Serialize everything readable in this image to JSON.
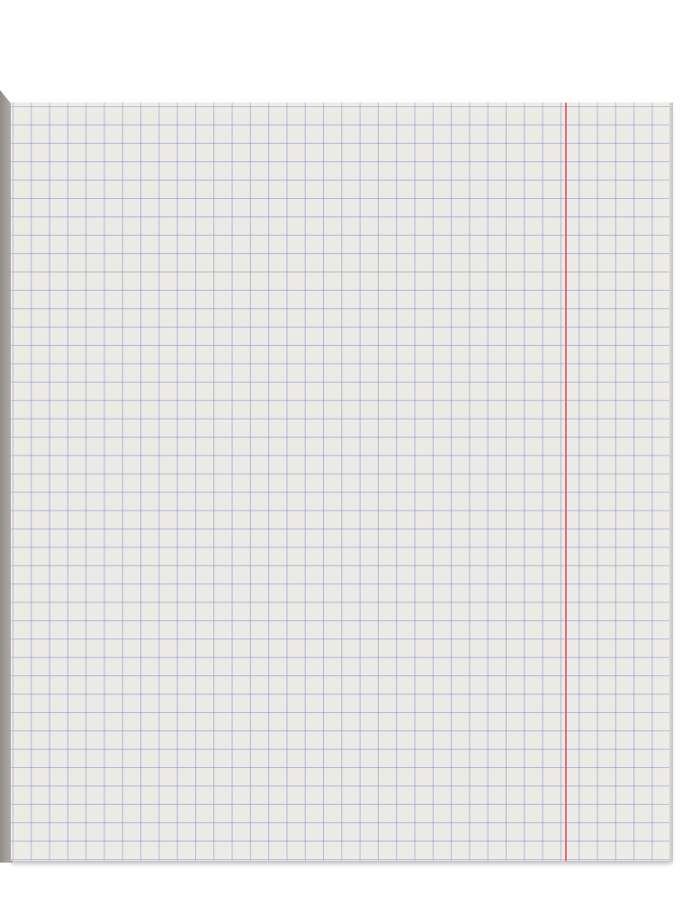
{
  "scene": {
    "subject": "graph-paper-notebook-page",
    "colors": {
      "background": "#ffffff",
      "paper": "#eceae4",
      "grid_line": "#788ccd",
      "margin_line": "#f0505f",
      "spine": "#a7a39f"
    }
  }
}
